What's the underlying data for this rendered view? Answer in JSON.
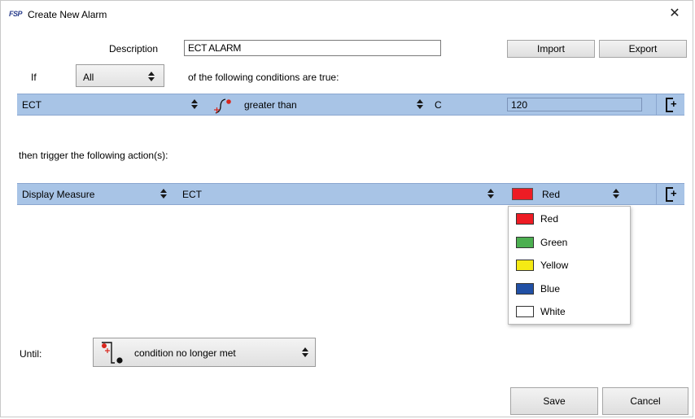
{
  "window": {
    "title": "Create New Alarm",
    "logo_text": "FSP",
    "close_symbol": "✕"
  },
  "description": {
    "label": "Description",
    "value": "ECT ALARM"
  },
  "buttons": {
    "import": "Import",
    "export": "Export",
    "save": "Save",
    "cancel": "Cancel"
  },
  "condition_header": {
    "if_label": "If",
    "mode_value": "All",
    "suffix_text": "of the following conditions are true:"
  },
  "condition_row": {
    "channel": "ECT",
    "operator": "greater than",
    "unit": "C",
    "threshold": "120",
    "icons": [
      "threshold-graph-icon",
      "add-row-icon"
    ]
  },
  "action_header": {
    "text": "then trigger the following action(s):"
  },
  "action_row": {
    "action": "Display Measure",
    "channel": "ECT",
    "color_label": "Red",
    "color_hex": "#ee1c24"
  },
  "color_dropdown": {
    "options": [
      {
        "label": "Red",
        "hex": "#ee1c24"
      },
      {
        "label": "Green",
        "hex": "#4caf50"
      },
      {
        "label": "Yellow",
        "hex": "#f5ea14"
      },
      {
        "label": "Blue",
        "hex": "#2150a5"
      },
      {
        "label": "White",
        "hex": "#ffffff"
      }
    ]
  },
  "until": {
    "label": "Until:",
    "value": "condition no longer met",
    "icon": "condition-end-icon"
  }
}
